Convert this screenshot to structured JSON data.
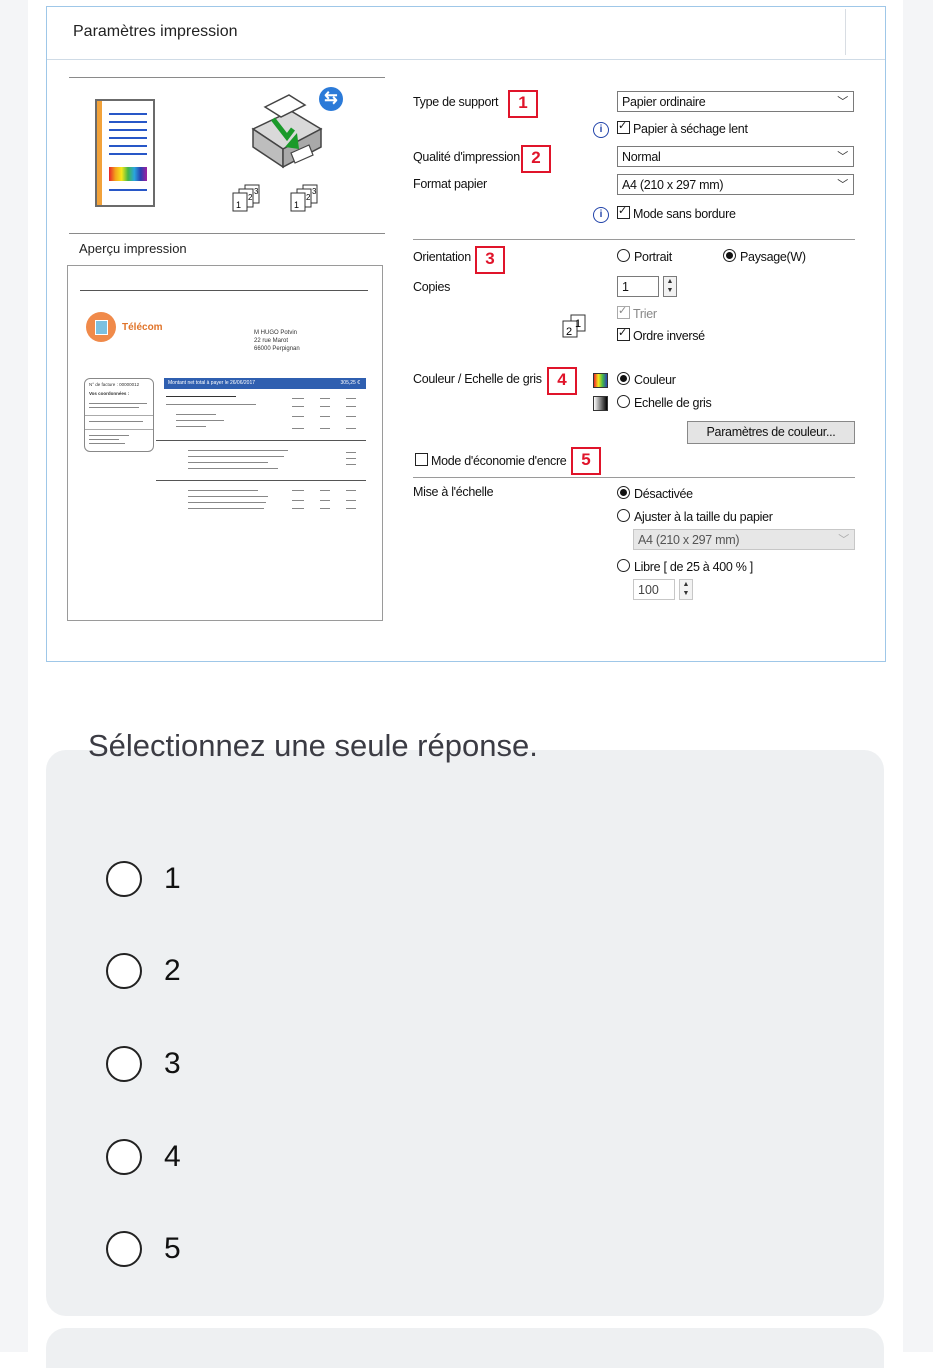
{
  "dialog": {
    "title": "Paramètres impression",
    "preview_label": "Aperçu impression",
    "preview_doc": {
      "company": "Télécom",
      "recipient": [
        "M HUGO Potvin",
        "22 rue Marot",
        "66000 Perpignan"
      ],
      "banner": "Montant net total à payer le 26/06/2017",
      "amount": "305,25 €",
      "left_box_1": "N° de facture : 00000012",
      "left_box_2": "Vos coordonnées :"
    },
    "badges": [
      "1",
      "2",
      "3",
      "4",
      "5"
    ],
    "type_support": {
      "label": "Type de support",
      "value": "Papier ordinaire",
      "checkbox": "Papier à séchage lent"
    },
    "qualite": {
      "label": "Qualité d'impression",
      "value": "Normal"
    },
    "format": {
      "label": "Format papier",
      "value": "A4 (210 x 297 mm)",
      "checkbox": "Mode sans bordure"
    },
    "orientation": {
      "label": "Orientation",
      "options": [
        "Portrait",
        "Paysage(W)"
      ],
      "selected": "Paysage(W)"
    },
    "copies": {
      "label": "Copies",
      "value": "1",
      "trier": "Trier",
      "ordre_inverse": "Ordre inversé"
    },
    "couleur": {
      "label": "Couleur / Echelle de gris",
      "options": [
        "Couleur",
        "Echelle de gris"
      ],
      "selected": "Couleur",
      "button": "Paramètres de couleur..."
    },
    "economie": {
      "label": "Mode d'économie d'encre"
    },
    "echelle": {
      "label": "Mise à l'échelle",
      "options": [
        "Désactivée",
        "Ajuster à la taille du papier",
        "Libre [ de 25 à 400 % ]"
      ],
      "selected": "Désactivée",
      "paper_value": "A4 (210 x 297 mm)",
      "libre_value": "100"
    }
  },
  "question": {
    "prompt": "Sélectionnez une seule réponse.",
    "options": [
      "1",
      "2",
      "3",
      "4",
      "5"
    ]
  },
  "colors": {
    "badge_red": "#e0142a",
    "frame_blue": "#9fc7e8",
    "card_bg": "#eef0f2"
  }
}
